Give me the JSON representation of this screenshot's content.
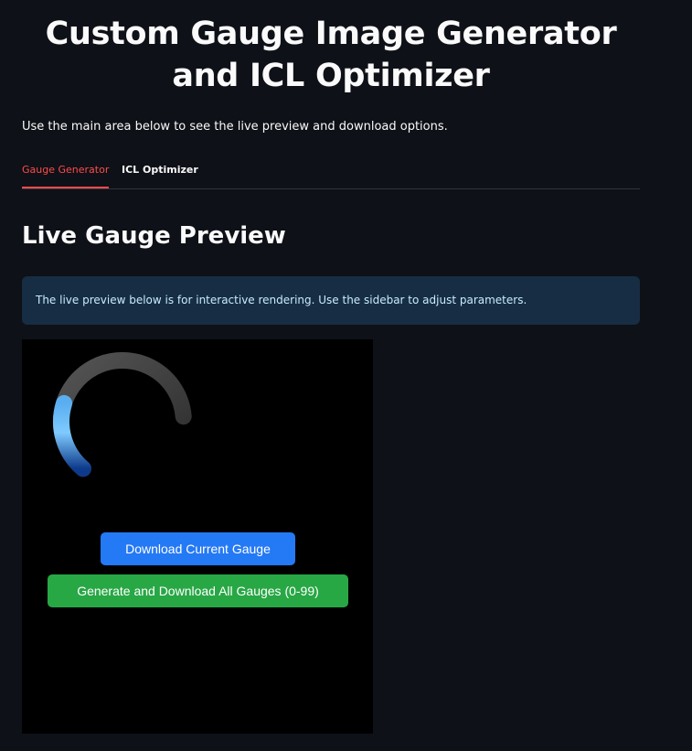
{
  "page": {
    "title": "Custom Gauge Image Generator and ICL Optimizer",
    "subtitle": "Use the main area below to see the live preview and download options."
  },
  "tabs": [
    {
      "label": "Gauge Generator",
      "active": true
    },
    {
      "label": "ICL Optimizer",
      "active": false
    }
  ],
  "preview": {
    "heading": "Live Gauge Preview",
    "info_text": "The live preview below is for interactive rendering. Use the sidebar to adjust parameters.",
    "gauge": {
      "value_fraction": 0.3,
      "fill_color_light": "#7cc8ff",
      "fill_color_dark": "#0d3a8a",
      "track_color": "#3a3a3a"
    },
    "buttons": {
      "download_current": "Download Current Gauge",
      "download_all": "Generate and Download All Gauges (0-99)"
    }
  },
  "colors": {
    "background": "#0e1117",
    "accent": "#ff4b4b",
    "info_bg": "#172d43",
    "download_button": "#2479f5",
    "generate_button": "#28a745"
  }
}
